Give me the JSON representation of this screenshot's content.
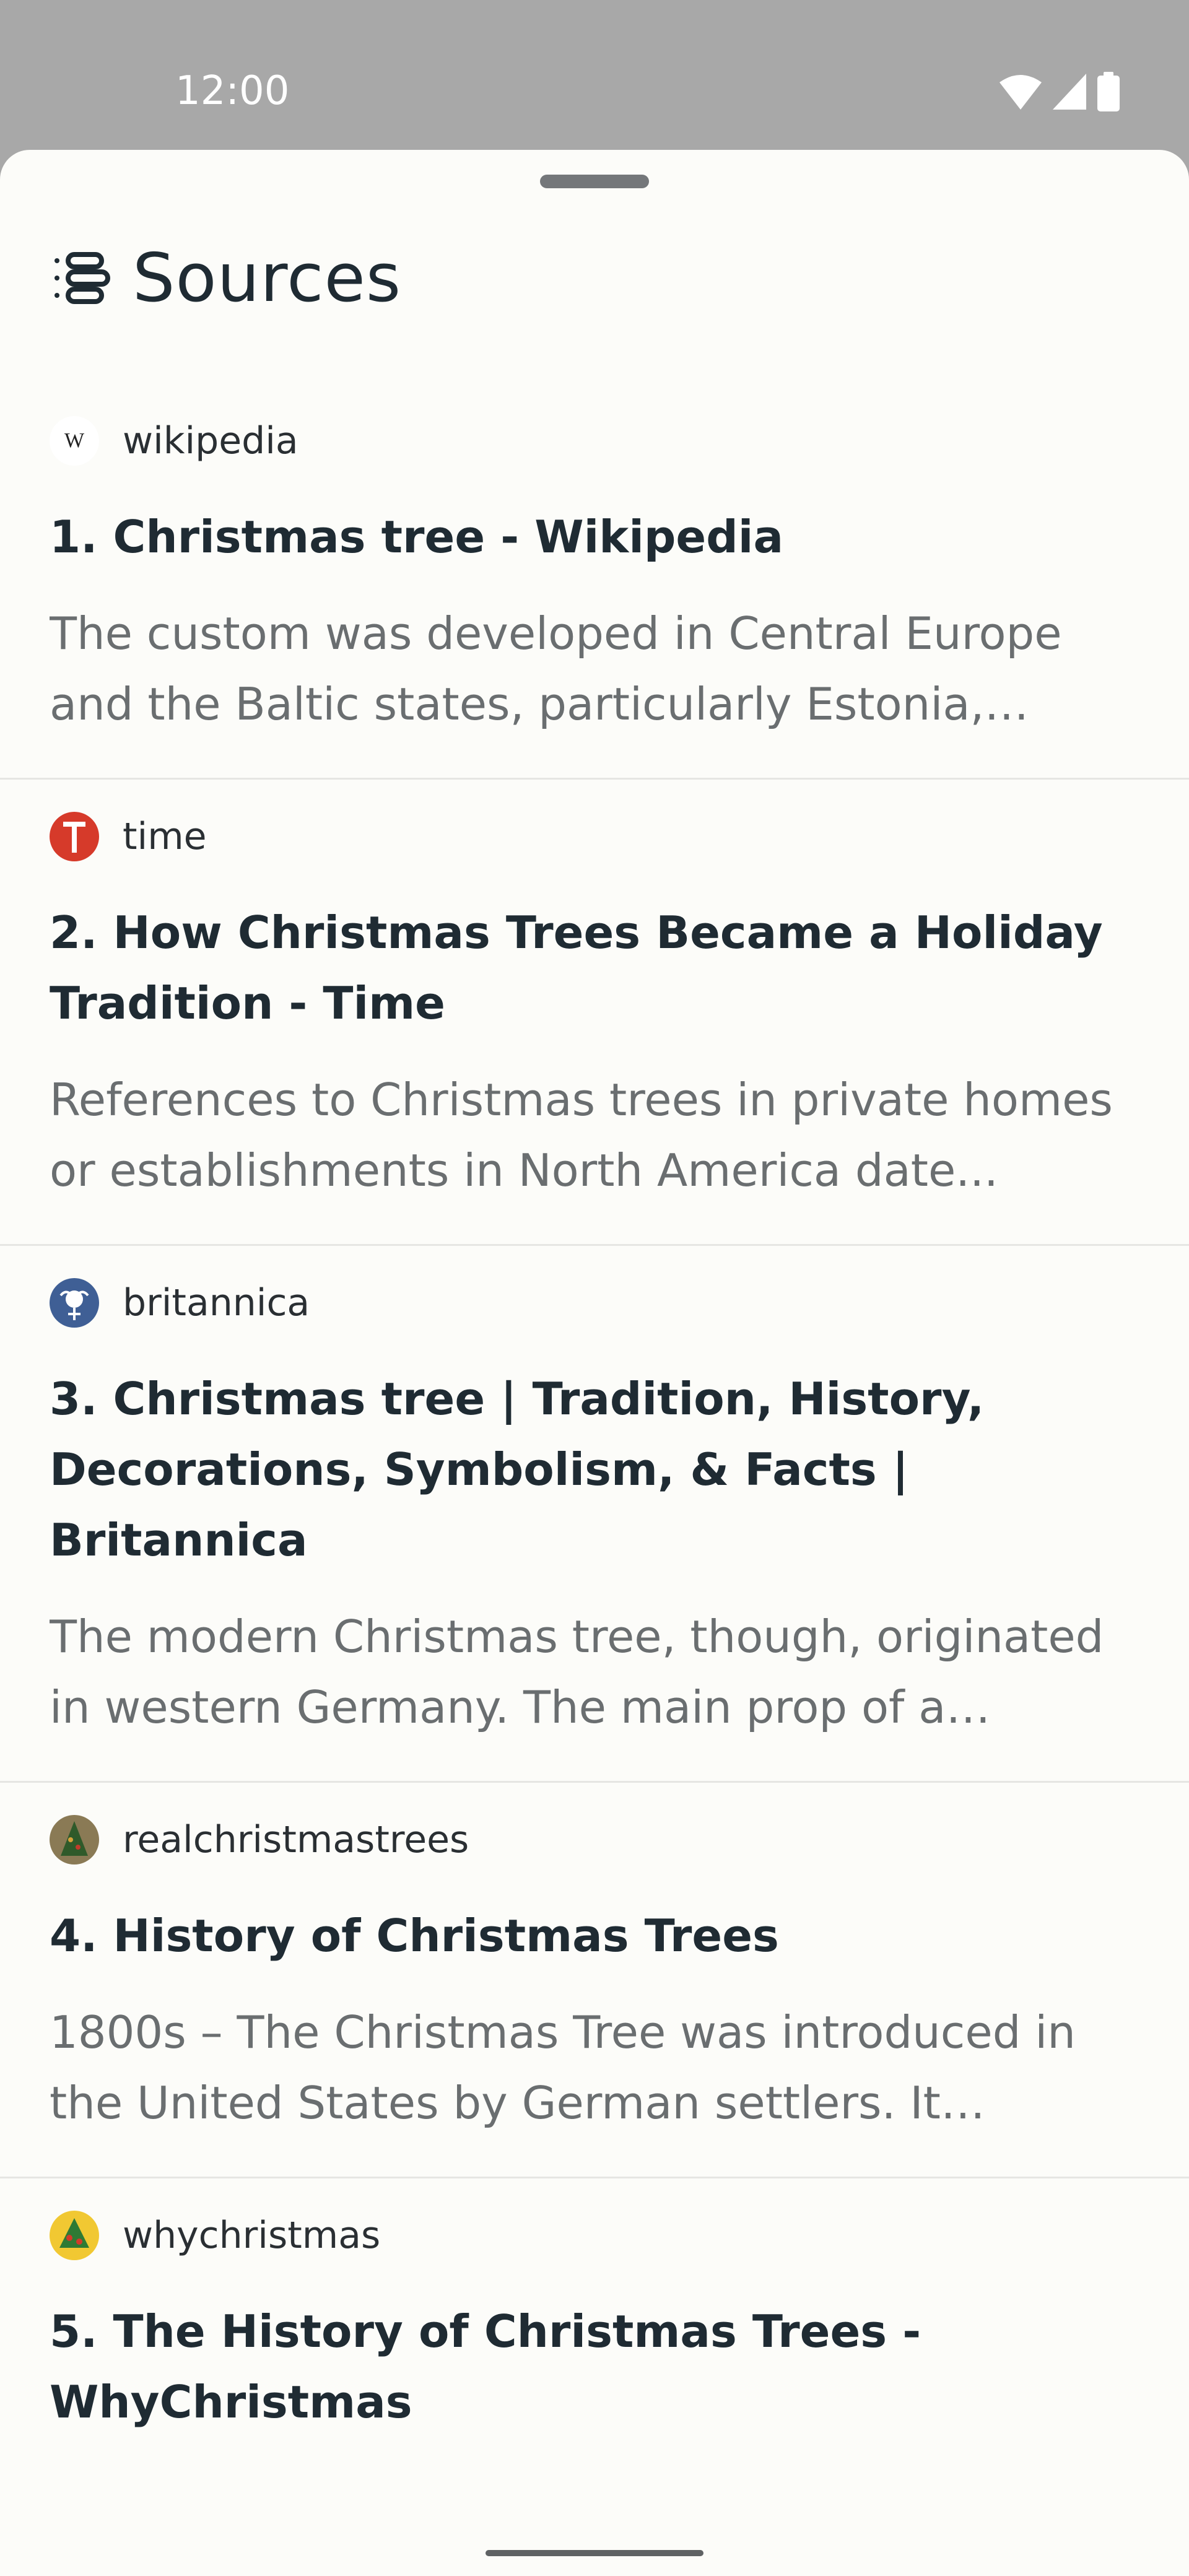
{
  "status_bar": {
    "time": "12:00",
    "icons": [
      "wifi-icon",
      "cellular-signal-icon",
      "battery-icon"
    ]
  },
  "sheet": {
    "title": "Sources",
    "title_icon": "list-sources-icon"
  },
  "sources": [
    {
      "domain": "wikipedia",
      "favicon": "wikipedia-favicon",
      "title": "1. Christmas tree - Wikipedia",
      "snippet": "The custom was developed in Central Europe and the Baltic states, particularly Estonia, Germany..."
    },
    {
      "domain": "time",
      "favicon": "time-favicon",
      "title": "2. How Christmas Trees Became a Holiday Tradition - Time",
      "snippet": "References to Christmas trees in private homes or establishments in North America date..."
    },
    {
      "domain": "britannica",
      "favicon": "britannica-favicon",
      "title": "3. Christmas tree | Tradition, History, Decorations, Symbolism, & Facts | Britannica",
      "snippet": "The modern Christmas tree, though, originated in western Germany. The main prop of a popular..."
    },
    {
      "domain": "realchristmastrees",
      "favicon": "realchristmastrees-favicon",
      "title": "4. History of Christmas Trees",
      "snippet": "1800s – The Christmas Tree was introduced in the United States by German settlers. It rapidly..."
    },
    {
      "domain": "whychristmas",
      "favicon": "whychristmas-favicon",
      "title": "5. The History of Christmas Trees - WhyChristmas",
      "snippet": ""
    }
  ],
  "colors": {
    "sheet_background": "#fcfcf9",
    "title_text": "#1f2b33",
    "snippet_text": "#6a6e70",
    "divider": "#e6e6e3",
    "time_red": "#d63a2a",
    "britannica_blue": "#3f5f95",
    "whychristmas_yellow": "#f1c832"
  }
}
